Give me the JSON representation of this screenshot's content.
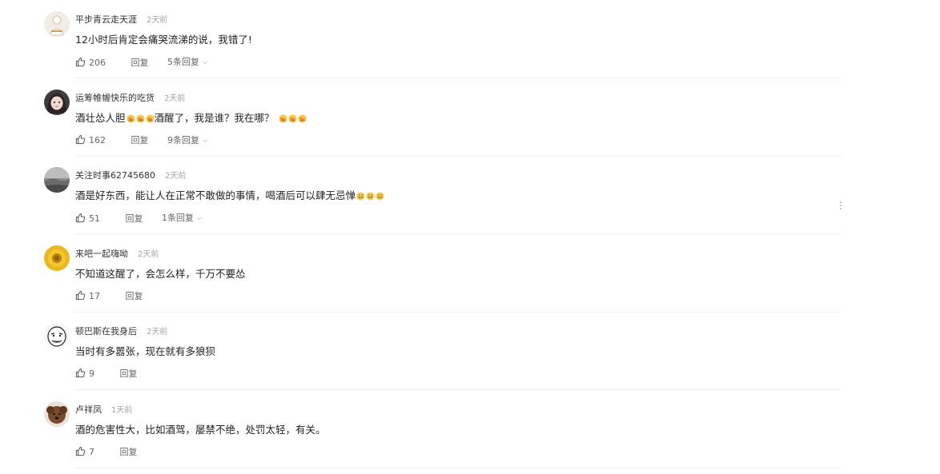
{
  "comments": [
    {
      "username": "平步青云走天涯",
      "time": "2天前",
      "text": "12小时后肯定会痛哭流涕的说，我错了!",
      "emoji_count": 0,
      "trailing_emoji_text": "",
      "trailing_emoji_count": 0,
      "likes": "206",
      "reply_label": "回复",
      "replies_label": "5条回复",
      "avatar_icon": "white-figure-avatar",
      "avatar_color": "#f1ede4"
    },
    {
      "username": "运筹帷幄快乐的吃货",
      "time": "2天前",
      "text": "酒壮怂人胆",
      "emoji_count": 3,
      "trailing_emoji_text": "酒醒了，我是谁？我在哪？",
      "trailing_emoji_count": 3,
      "emoji_kind": "facepalm",
      "likes": "162",
      "reply_label": "回复",
      "replies_label": "9条回复",
      "avatar_icon": "girl-avatar",
      "avatar_color": "#3f3b3d"
    },
    {
      "username": "关注时事62745680",
      "time": "2天前",
      "text": "酒是好东西，能让人在正常不敢做的事情，喝酒后可以肆无忌惮",
      "emoji_count": 3,
      "emoji_kind": "grin",
      "trailing_emoji_text": "",
      "trailing_emoji_count": 0,
      "likes": "51",
      "reply_label": "回复",
      "replies_label": "1条回复",
      "avatar_icon": "landscape-avatar",
      "avatar_color": "#6b6b6b",
      "show_more_menu": true
    },
    {
      "username": "来吧一起嗨呦",
      "time": "2天前",
      "text": "不知道这醒了，会怎么样，千万不要怂",
      "emoji_count": 0,
      "trailing_emoji_text": "",
      "trailing_emoji_count": 0,
      "likes": "17",
      "reply_label": "回复",
      "replies_label": "",
      "avatar_icon": "sunflower-avatar",
      "avatar_color": "#e8b81e"
    },
    {
      "username": "顿巴斯在我身后",
      "time": "2天前",
      "text": "当时有多嚣张，现在就有多狼狈",
      "emoji_count": 0,
      "trailing_emoji_text": "",
      "trailing_emoji_count": 0,
      "likes": "9",
      "reply_label": "回复",
      "replies_label": "",
      "avatar_icon": "meme-face-avatar",
      "avatar_color": "#f5f5f5"
    },
    {
      "username": "卢祥凤",
      "time": "1天前",
      "text": "酒的危害性大，比如酒驾，屡禁不绝，处罚太轻，有关。",
      "emoji_count": 0,
      "trailing_emoji_text": "",
      "trailing_emoji_count": 0,
      "likes": "7",
      "reply_label": "回复",
      "replies_label": "",
      "avatar_icon": "dog-avatar",
      "avatar_color": "#7a4a2c"
    }
  ],
  "more_menu_icon": "vertical-ellipsis-icon",
  "like_icon": "thumbs-up-icon",
  "chevron_icon": "chevron-down-icon"
}
